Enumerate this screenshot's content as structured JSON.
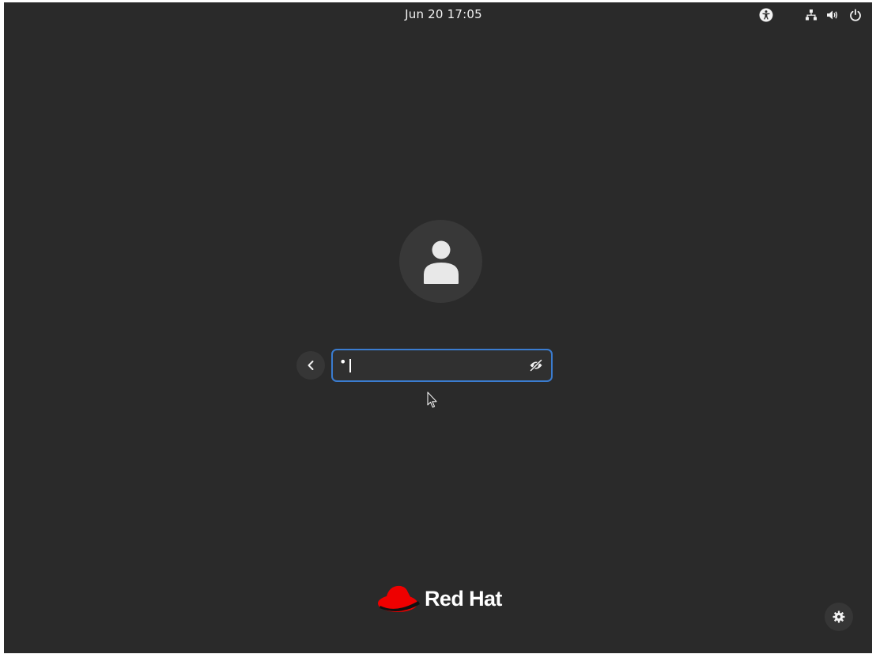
{
  "topbar": {
    "clock": "Jun 20  17:05",
    "icons": [
      "accessibility-icon",
      "network-wired-icon",
      "volume-icon",
      "power-icon"
    ]
  },
  "login": {
    "avatar_icon": "user-avatar-icon",
    "back_icon": "chevron-left-icon",
    "password_value": "•",
    "reveal_icon": "eye-slash-icon",
    "focus_color": "#3a7cd0"
  },
  "branding": {
    "text": "Red Hat",
    "logo_color": "#ee0000"
  },
  "settings": {
    "icon": "gear-icon"
  },
  "colors": {
    "background": "#2a2a2a",
    "text": "#ffffff"
  }
}
